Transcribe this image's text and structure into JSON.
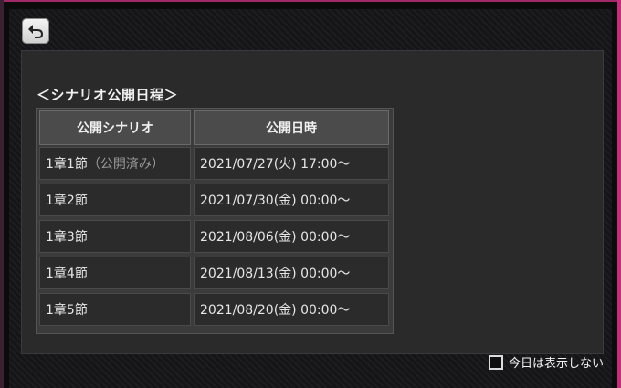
{
  "back_button": {
    "icon": "back-arrow-icon"
  },
  "section_title": "＜シナリオ公開日程＞",
  "table": {
    "headers": [
      "公開シナリオ",
      "公開日時"
    ],
    "rows": [
      {
        "scenario": "1章1節",
        "status": "（公開済み）",
        "datetime": "2021/07/27(火) 17:00〜"
      },
      {
        "scenario": "1章2節",
        "status": "",
        "datetime": "2021/07/30(金) 00:00〜"
      },
      {
        "scenario": "1章3節",
        "status": "",
        "datetime": "2021/08/06(金) 00:00〜"
      },
      {
        "scenario": "1章4節",
        "status": "",
        "datetime": "2021/08/13(金) 00:00〜"
      },
      {
        "scenario": "1章5節",
        "status": "",
        "datetime": "2021/08/20(金) 00:00〜"
      }
    ]
  },
  "footer": {
    "dont_show_today_label": "今日は表示しない",
    "checked": false
  },
  "colors": {
    "accent_frame": "#c0307a",
    "panel": "#2a2a2b"
  }
}
